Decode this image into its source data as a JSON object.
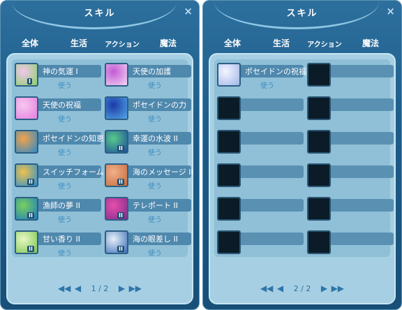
{
  "left": {
    "title": "スキル",
    "close": "×",
    "tabs": [
      "全体",
      "生活",
      "アクション",
      "魔法"
    ],
    "skills": [
      {
        "name": "神の気運 I",
        "use": "使う",
        "icon": "leaf-icon",
        "level": "I",
        "colors": [
          "#f3c6ee",
          "#8ad06a"
        ]
      },
      {
        "name": "天使の加護",
        "use": "使う",
        "icon": "angel-icon",
        "level": "",
        "colors": [
          "#c25ad6",
          "#f2d6f2"
        ]
      },
      {
        "name": "天使の祝福",
        "use": "使う",
        "icon": "feather-icon",
        "level": "",
        "colors": [
          "#f6c8ee",
          "#e57ee0"
        ]
      },
      {
        "name": "ポセイドンの力",
        "use": "使う",
        "icon": "whirlpool-icon",
        "level": "",
        "colors": [
          "#1b3aa7",
          "#53a6e6"
        ]
      },
      {
        "name": "ポセイドンの知恵",
        "use": "使う",
        "icon": "sunset-icon",
        "level": "",
        "colors": [
          "#f2a24b",
          "#2f8ac5"
        ]
      },
      {
        "name": "幸運の水波 II",
        "use": "使う",
        "icon": "water-icon",
        "level": "II",
        "colors": [
          "#58c98a",
          "#1d4f9a"
        ]
      },
      {
        "name": "スイッチフォーム II",
        "use": "使う",
        "icon": "switch-icon",
        "level": "II",
        "colors": [
          "#f1c24a",
          "#2a8fd1"
        ]
      },
      {
        "name": "海のメッセージ II",
        "use": "使う",
        "icon": "shell-icon",
        "level": "II",
        "colors": [
          "#f0b08a",
          "#c76a3b"
        ]
      },
      {
        "name": "漁師の夢 II",
        "use": "使う",
        "icon": "fishing-icon",
        "level": "II",
        "colors": [
          "#78d05a",
          "#1f7bc3"
        ]
      },
      {
        "name": "テレポート II",
        "use": "使う",
        "icon": "teleport-icon",
        "level": "II",
        "colors": [
          "#e64ea9",
          "#7d2d8d"
        ]
      },
      {
        "name": "甘い香り II",
        "use": "使う",
        "icon": "flower-icon",
        "level": "II",
        "colors": [
          "#e8f7c4",
          "#7ac650"
        ]
      },
      {
        "name": "海の眼差し II",
        "use": "使う",
        "icon": "eye-icon",
        "level": "II",
        "colors": [
          "#e7eff7",
          "#3b6fb8"
        ]
      }
    ],
    "pager": {
      "first": "◀◀",
      "prev": "◀",
      "text": "1 / 2",
      "next": "▶",
      "last": "▶▶"
    }
  },
  "right": {
    "title": "スキル",
    "close": "×",
    "tabs": [
      "全体",
      "生活",
      "アクション",
      "魔法"
    ],
    "skills": [
      {
        "name": "ポセイドンの祝福",
        "use": "使う",
        "icon": "cross-icon",
        "level": "",
        "colors": [
          "#f4f4ff",
          "#9fb6e6"
        ]
      }
    ],
    "empty_slots": 11,
    "pager": {
      "first": "◀◀",
      "prev": "◀",
      "text": "2 / 2",
      "next": "▶",
      "last": "▶▶"
    }
  }
}
